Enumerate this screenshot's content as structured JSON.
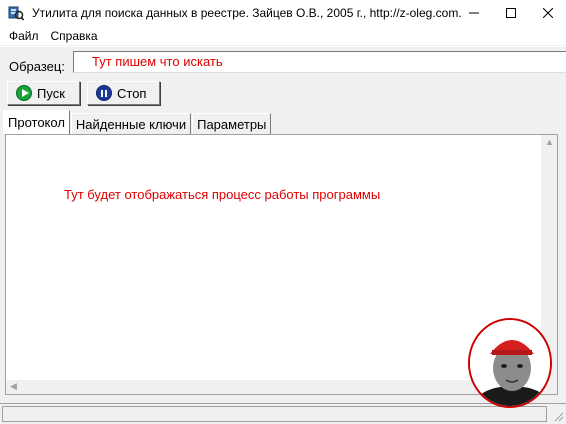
{
  "window": {
    "title": "Утилита для поиска данных в реестре. Зайцев О.В., 2005 г., http://z-oleg.com...",
    "minimize_glyph": "—",
    "maximize_glyph": "☐",
    "close_glyph": "✕"
  },
  "menu": {
    "items": [
      {
        "label": "Файл"
      },
      {
        "label": "Справка"
      }
    ]
  },
  "search": {
    "label": "Образец:",
    "value": "Тут пишем что искать"
  },
  "toolbar": {
    "start_label": "Пуск",
    "stop_label": "Стоп"
  },
  "tabs": [
    {
      "label": "Протокол",
      "active": true
    },
    {
      "label": "Найденные ключи",
      "active": false
    },
    {
      "label": "Параметры",
      "active": false
    }
  ],
  "panel": {
    "text": "Тут будет отображаться процесс работы программы"
  },
  "icons": {
    "app": "registry-search-icon",
    "start": "play-icon",
    "stop": "pause-icon"
  },
  "colors": {
    "hint_text": "#e00000",
    "start_icon": "#16a33a",
    "stop_icon": "#1b3a9a",
    "avatar_border": "#cc0000"
  }
}
